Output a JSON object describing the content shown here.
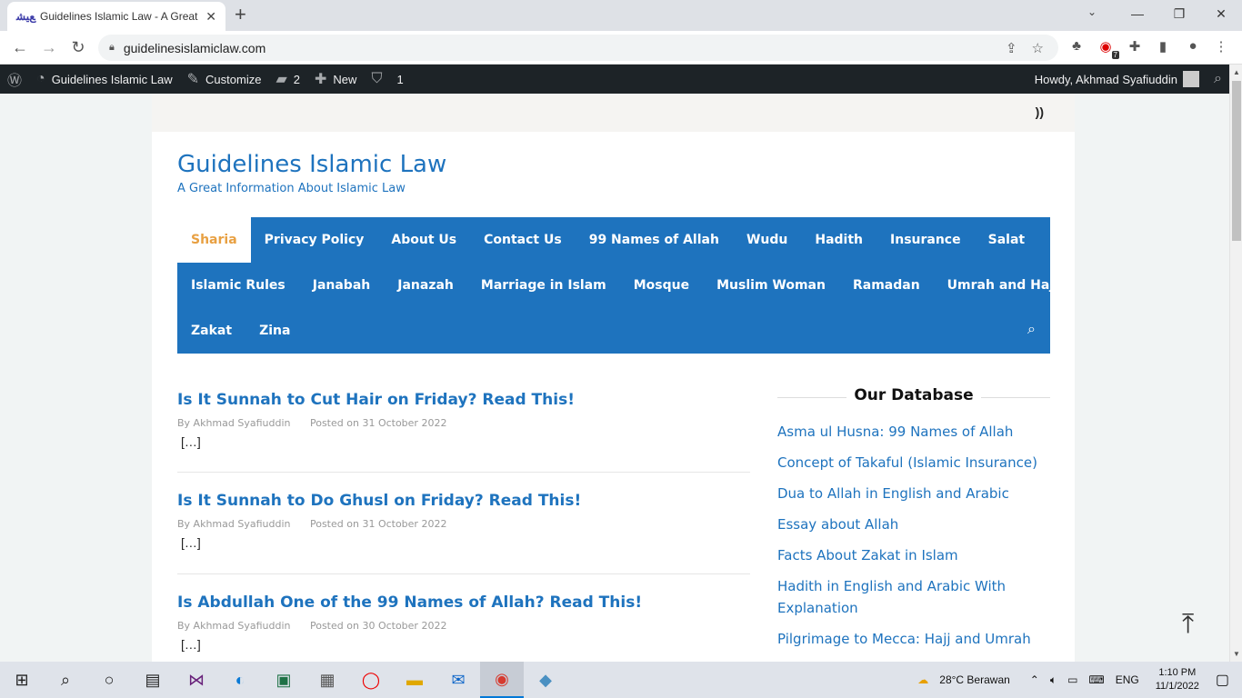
{
  "browser": {
    "tab_title": "Guidelines Islamic Law - A Great",
    "tab_favicon": "ﻊﻴﺸ",
    "url": "guidelinesislamiclaw.com",
    "ext_badge": "7"
  },
  "adminbar": {
    "site_name": "Guidelines Islamic Law",
    "customize": "Customize",
    "comments_count": "2",
    "new_label": "New",
    "yoast_count": "1",
    "howdy": "Howdy, Akhmad Syafiuddin"
  },
  "site": {
    "title": "Guidelines Islamic Law",
    "tagline": "A Great Information About Islamic Law"
  },
  "nav": {
    "row1": [
      "Sharia",
      "Privacy Policy",
      "About Us",
      "Contact Us",
      "99 Names of Allah",
      "Wudu",
      "Hadith",
      "Insurance",
      "Salat"
    ],
    "row2": [
      "Islamic Rules",
      "Janabah",
      "Janazah",
      "Marriage in Islam",
      "Mosque",
      "Muslim Woman",
      "Ramadan",
      "Umrah and Hajj"
    ],
    "row3": [
      "Zakat",
      "Zina"
    ],
    "active": "Sharia"
  },
  "posts": [
    {
      "title": "Is It Sunnah to Cut Hair on Friday? Read This!",
      "author": "By Akhmad Syafiuddin",
      "date": "Posted on 31 October 2022",
      "excerpt": "[…]"
    },
    {
      "title": "Is It Sunnah to Do Ghusl on Friday? Read This!",
      "author": "By Akhmad Syafiuddin",
      "date": "Posted on 31 October 2022",
      "excerpt": "[…]"
    },
    {
      "title": "Is Abdullah One of the 99 Names of Allah? Read This!",
      "author": "By Akhmad Syafiuddin",
      "date": "Posted on 30 October 2022",
      "excerpt": "[…]"
    }
  ],
  "sidebar": {
    "title": "Our Database",
    "links": [
      "Asma ul Husna: 99 Names of Allah",
      "Concept of Takaful (Islamic Insurance)",
      "Dua to Allah in English and Arabic",
      "Essay about Allah",
      "Facts About Zakat in Islam",
      "Hadith in English and Arabic With Explanation",
      "Pilgrimage to Mecca: Hajj and Umrah"
    ]
  },
  "taskbar": {
    "weather": "28°C  Berawan",
    "lang": "ENG",
    "time": "1:10 PM",
    "date": "11/1/2022"
  },
  "colors": {
    "accent": "#1e73be",
    "active_nav": "#e8a042",
    "adminbar": "#1d2327"
  }
}
